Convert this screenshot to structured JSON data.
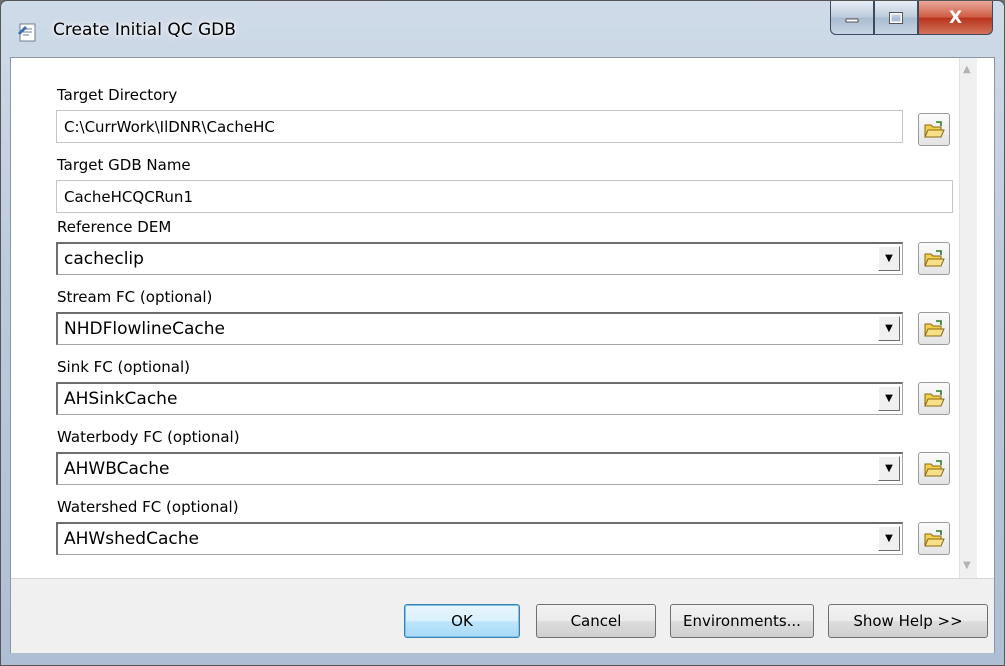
{
  "window": {
    "title": "Create Initial QC GDB",
    "controls": {
      "minimize": "–",
      "maximize": "□",
      "close": "X"
    }
  },
  "form": {
    "target_directory": {
      "label": "Target Directory",
      "value": "C:\\CurrWork\\IlDNR\\CacheHC"
    },
    "target_gdb_name": {
      "label": "Target GDB Name",
      "value": "CacheHCQCRun1"
    },
    "reference_dem": {
      "label": "Reference DEM",
      "value": "cacheclip"
    },
    "stream_fc": {
      "label": "Stream FC (optional)",
      "value": "NHDFlowlineCache"
    },
    "sink_fc": {
      "label": "Sink FC (optional)",
      "value": "AHSinkCache"
    },
    "waterbody_fc": {
      "label": "Waterbody FC (optional)",
      "value": "AHWBCache"
    },
    "watershed_fc": {
      "label": "Watershed FC (optional)",
      "value": "AHWshedCache"
    }
  },
  "buttons": {
    "ok": "OK",
    "cancel": "Cancel",
    "environments": "Environments...",
    "show_help": "Show Help >>"
  },
  "icons": {
    "app": "python-script-tool-icon",
    "browse": "open-folder-icon",
    "dropdown": "dropdown-arrow-icon"
  },
  "colors": {
    "folder_yellow": "#f3cf4e",
    "close_red": "#c8402a",
    "default_button_border": "#3c7fb1"
  }
}
